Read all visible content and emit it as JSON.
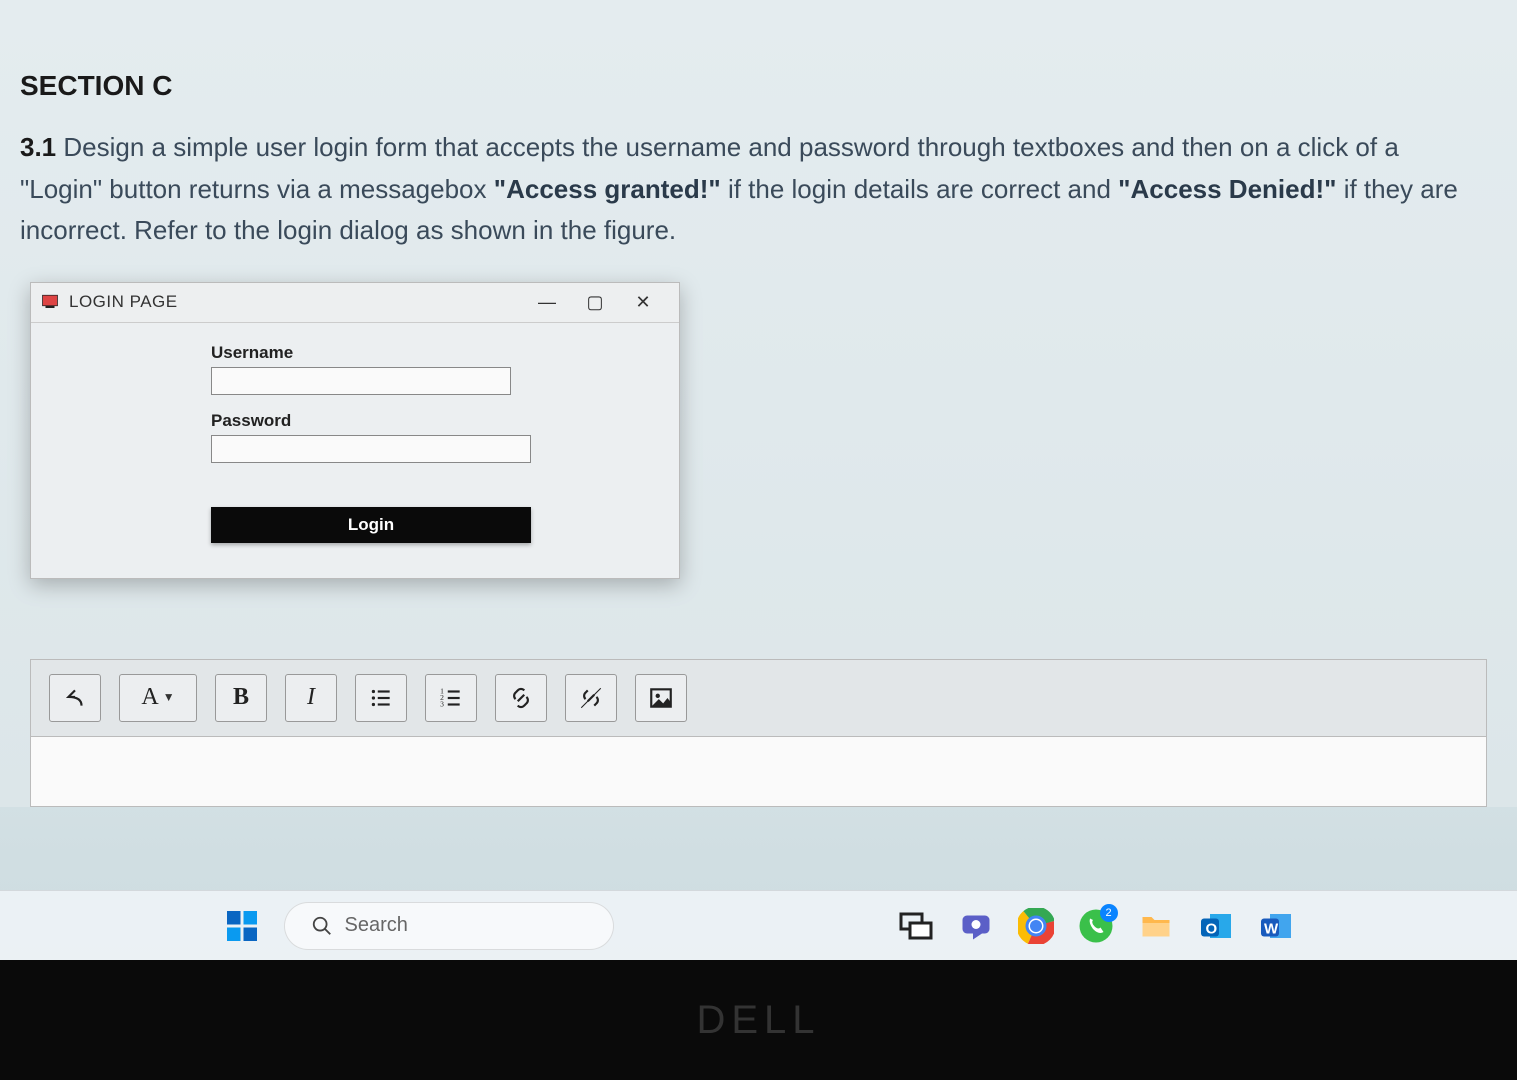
{
  "section": {
    "title": "SECTION C"
  },
  "question": {
    "number": "3.1",
    "p1": " Design a simple user login form that accepts the username and password through textboxes and then on a click of a \"Login\" button returns via a messagebox ",
    "b1": "\"Access granted!\"",
    "p2": " if the login details are correct and ",
    "b2": "\"Access Denied!\"",
    "p3": " if they are incorrect. Refer to the login dialog as shown in the figure."
  },
  "dialog": {
    "title": "LOGIN PAGE",
    "username_label": "Username",
    "password_label": "Password",
    "login_button": "Login"
  },
  "toolbar": {
    "font_letter": "A",
    "bold": "B",
    "italic": "I"
  },
  "taskbar": {
    "search_placeholder": "Search",
    "badge_count": "2"
  },
  "bezel": {
    "logo": "DELL"
  }
}
